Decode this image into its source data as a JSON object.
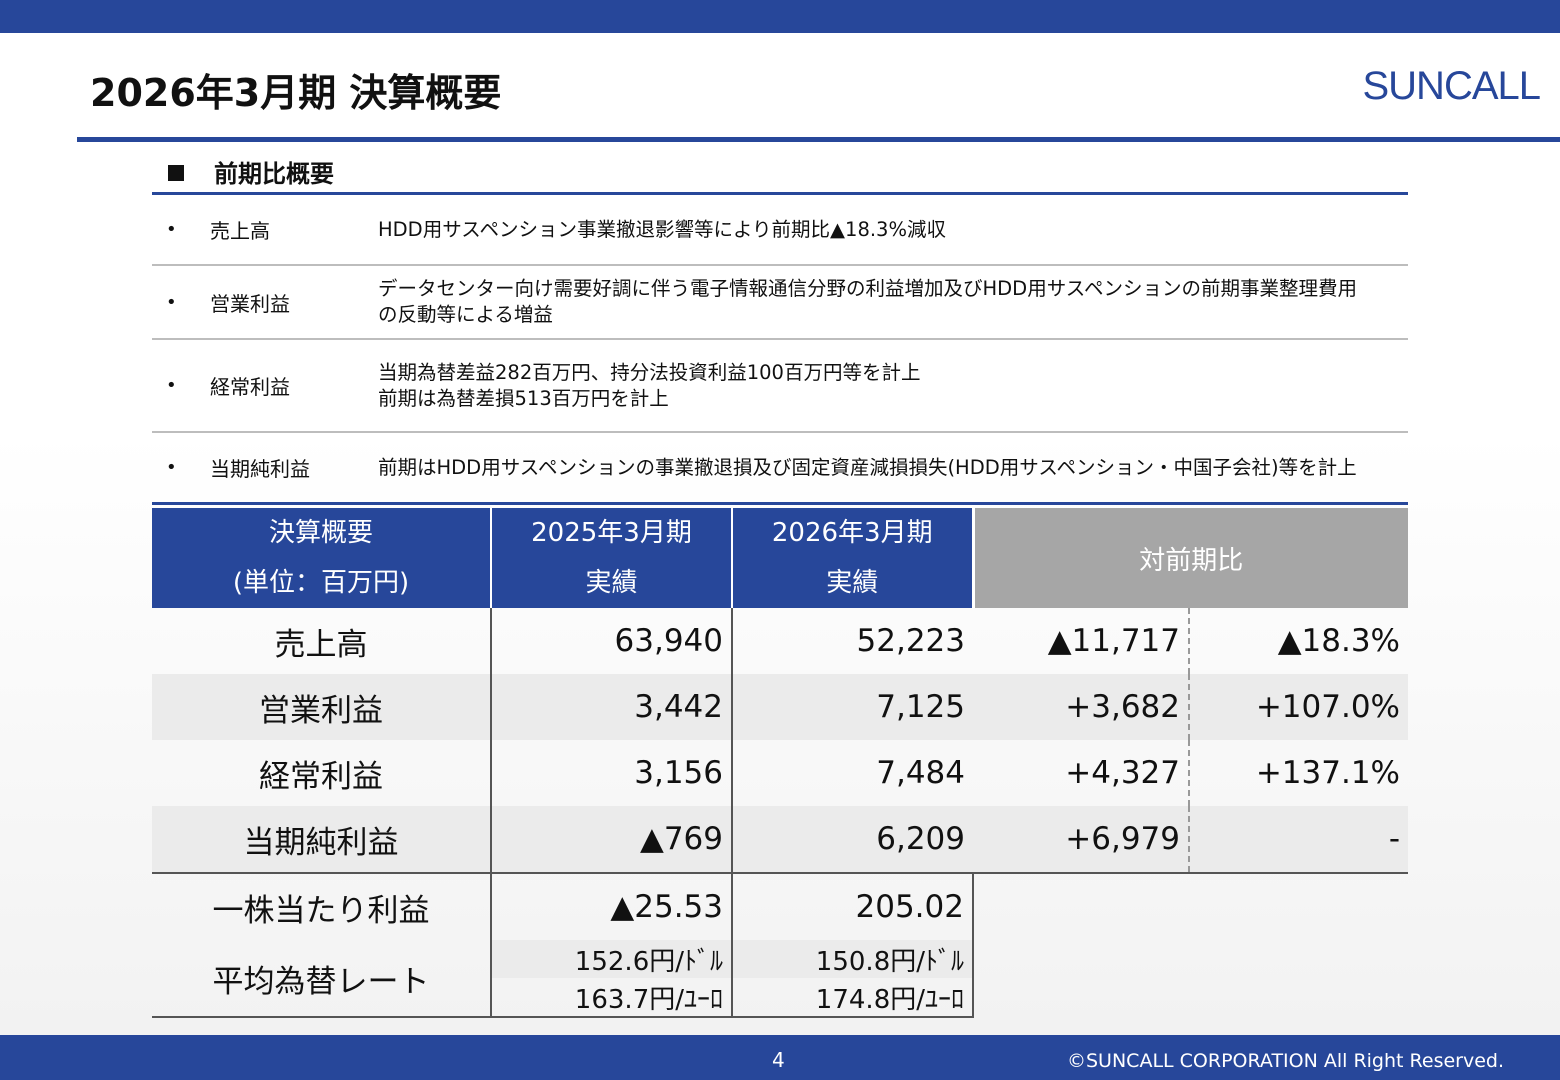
{
  "header": {
    "title": "2026年3月期 決算概要",
    "logo": "SUNCALL"
  },
  "section": {
    "heading": "前期比概要"
  },
  "bullets": [
    {
      "dot": "•",
      "label": "売上高",
      "lines": [
        "HDD用サスペンション事業撤退影響等により前期比▲18.3%減収"
      ]
    },
    {
      "dot": "•",
      "label": "営業利益",
      "lines": [
        "データセンター向け需要好調に伴う電子情報通信分野の利益増加及びHDD用サスペンションの前期事業整理費用",
        "の反動等による増益"
      ]
    },
    {
      "dot": "•",
      "label": "経常利益",
      "lines": [
        "当期為替差益282百万円、持分法投資利益100百万円等を計上",
        "前期は為替差損513百万円を計上"
      ]
    },
    {
      "dot": "•",
      "label": "当期純利益",
      "lines": [
        "前期はHDD用サスペンションの事業撤退損及び固定資産減損損失(HDD用サスペンション・中国子会社)等を計上"
      ]
    }
  ],
  "table": {
    "header": {
      "col1_line1": "決算概要",
      "col1_line2": "(単位：百万円)",
      "col2_line1": "2025年3月期",
      "col2_line2": "実績",
      "col3_line1": "2026年3月期",
      "col3_line2": "実績",
      "col4": "対前期比"
    },
    "rows": [
      {
        "name": "売上高",
        "prev": "63,940",
        "curr": "52,223",
        "diff": "▲11,717",
        "pct": "▲18.3%"
      },
      {
        "name": "営業利益",
        "prev": "3,442",
        "curr": "7,125",
        "diff": "+3,682",
        "pct": "+107.0%"
      },
      {
        "name": "経常利益",
        "prev": "3,156",
        "curr": "7,484",
        "diff": "+4,327",
        "pct": "+137.1%"
      },
      {
        "name": "当期純利益",
        "prev": "▲769",
        "curr": "6,209",
        "diff": "+6,979",
        "pct": "-"
      }
    ],
    "eps": {
      "name": "一株当たり利益",
      "prev": "▲25.53",
      "curr": "205.02"
    },
    "fx": {
      "name": "平均為替レート",
      "prev_usd": "152.6円/ﾄﾞﾙ",
      "curr_usd": "150.8円/ﾄﾞﾙ",
      "prev_eur": "163.7円/ﾕｰﾛ",
      "curr_eur": "174.8円/ﾕｰﾛ"
    }
  },
  "footer": {
    "page": "4",
    "copyright": "©SUNCALL CORPORATION All Right Reserved."
  }
}
